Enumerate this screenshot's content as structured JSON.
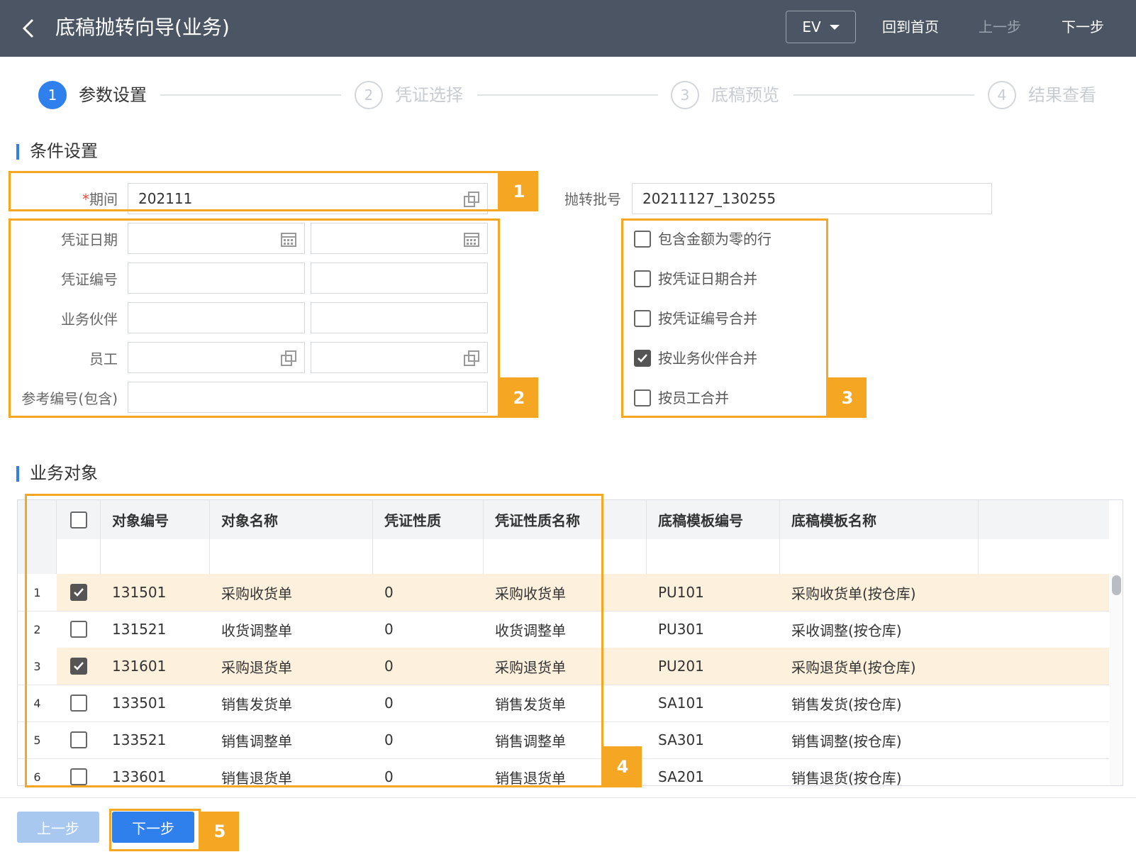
{
  "header": {
    "title": "底稿抛转向导(业务)",
    "ev_label": "EV",
    "home_label": "回到首页",
    "prev_label": "上一步",
    "next_label": "下一步"
  },
  "steps": [
    {
      "num": "1",
      "label": "参数设置"
    },
    {
      "num": "2",
      "label": "凭证选择"
    },
    {
      "num": "3",
      "label": "底稿预览"
    },
    {
      "num": "4",
      "label": "结果查看"
    }
  ],
  "conditions": {
    "section_title": "条件设置",
    "period_required_mark": "*",
    "period_label": "期间",
    "period_value": "202111",
    "batch_label": "抛转批号",
    "batch_value": "20211127_130255",
    "voucher_date_label": "凭证日期",
    "voucher_no_label": "凭证编号",
    "partner_label": "业务伙伴",
    "employee_label": "员工",
    "ref_no_label": "参考编号(包含)"
  },
  "options": [
    {
      "label": "包含金额为零的行",
      "checked": false
    },
    {
      "label": "按凭证日期合并",
      "checked": false
    },
    {
      "label": "按凭证编号合并",
      "checked": false
    },
    {
      "label": "按业务伙伴合并",
      "checked": true
    },
    {
      "label": "按员工合并",
      "checked": false
    }
  ],
  "objects": {
    "section_title": "业务对象",
    "columns": [
      "对象编号",
      "对象名称",
      "凭证性质",
      "凭证性质名称",
      "",
      "底稿模板编号",
      "底稿模板名称"
    ],
    "rows": [
      {
        "idx": "1",
        "checked": true,
        "code": "131501",
        "name": "采购收货单",
        "nature": "0",
        "nature_name": "采购收货单",
        "tpl_code": "PU101",
        "tpl_name": "采购收货单(按仓库)"
      },
      {
        "idx": "2",
        "checked": false,
        "code": "131521",
        "name": "收货调整单",
        "nature": "0",
        "nature_name": "收货调整单",
        "tpl_code": "PU301",
        "tpl_name": "采收调整(按仓库)"
      },
      {
        "idx": "3",
        "checked": true,
        "code": "131601",
        "name": "采购退货单",
        "nature": "0",
        "nature_name": "采购退货单",
        "tpl_code": "PU201",
        "tpl_name": "采购退货单(按仓库)"
      },
      {
        "idx": "4",
        "checked": false,
        "code": "133501",
        "name": "销售发货单",
        "nature": "0",
        "nature_name": "销售发货单",
        "tpl_code": "SA101",
        "tpl_name": "销售发货(按仓库)"
      },
      {
        "idx": "5",
        "checked": false,
        "code": "133521",
        "name": "销售调整单",
        "nature": "0",
        "nature_name": "销售调整单",
        "tpl_code": "SA301",
        "tpl_name": "销售调整(按仓库)"
      },
      {
        "idx": "6",
        "checked": false,
        "code": "133601",
        "name": "销售退货单",
        "nature": "0",
        "nature_name": "销售退货单",
        "tpl_code": "SA201",
        "tpl_name": "销售退货(按仓库)"
      }
    ]
  },
  "footer": {
    "prev_label": "上一步",
    "next_label": "下一步"
  },
  "callouts": [
    "1",
    "2",
    "3",
    "4",
    "5"
  ],
  "colors": {
    "header_bg": "#4b5563",
    "accent": "#2f80ed",
    "highlight": "#f5a623",
    "selected_row": "#fdf0dd"
  }
}
